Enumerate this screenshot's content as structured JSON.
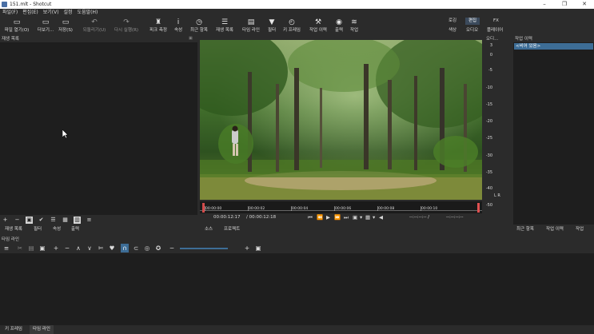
{
  "window": {
    "title": "151.mlt - Shotcut",
    "minimize": "–",
    "maximize": "❐",
    "close": "✕"
  },
  "menu": [
    "파일(F)",
    "편집(E)",
    "보기(V)",
    "설정",
    "도움말(H)"
  ],
  "toolbar": [
    {
      "icon": "▭",
      "label": "파일 열기(O)"
    },
    {
      "icon": "▭",
      "label": "더보기..."
    },
    {
      "icon": "▭",
      "label": "저장(S)"
    },
    {
      "icon": "↶",
      "label": "되돌리기(U)"
    },
    {
      "icon": "↷",
      "label": "다시 실행(R)"
    },
    {
      "icon": "♜",
      "label": "피크 측정"
    },
    {
      "icon": "i",
      "label": "속성"
    },
    {
      "icon": "◷",
      "label": "최근 항목"
    },
    {
      "icon": "☰",
      "label": "재생 목록"
    },
    {
      "icon": "▤",
      "label": "타임 라인"
    },
    {
      "icon": "▼",
      "label": "필터"
    },
    {
      "icon": "◴",
      "label": "키 프레임"
    },
    {
      "icon": "⚒",
      "label": "작업 이력"
    },
    {
      "icon": "◉",
      "label": "출력"
    },
    {
      "icon": "≋",
      "label": "작업"
    }
  ],
  "layouts": {
    "row1": [
      "로깅",
      "편집",
      "FX"
    ],
    "row2": [
      "색상",
      "오디오",
      "플레이어"
    ],
    "active": "편집"
  },
  "playlist": {
    "title": "재생 목록",
    "tools": [
      "+",
      "−",
      "▣",
      "✔",
      "☰",
      "▦",
      "▥",
      "≡"
    ],
    "tabs": [
      "재생 목록",
      "필터",
      "속성",
      "출력"
    ]
  },
  "player": {
    "current_time": "00:00:12:17",
    "total_time": "/ 00:00:12:18",
    "ruler": [
      "00:00:00",
      "00:00:02",
      "00:00:04",
      "00:00:06",
      "00:00:08",
      "00:00:10"
    ],
    "in_point": "--:--:--:-- /",
    "out_point": "--:--:--:--",
    "tabs": [
      "소스",
      "프로젝트"
    ]
  },
  "meter": {
    "title": "오디...",
    "ticks": [
      "3",
      "0",
      "-5",
      "-10",
      "-15",
      "-20",
      "-25",
      "-30",
      "-35",
      "-40",
      "-50"
    ],
    "channels": "L R"
  },
  "history": {
    "title": "작업 이력",
    "items": [
      "<비어 있음>"
    ],
    "tabs": [
      "최근 항목",
      "작업 이력",
      "작업"
    ]
  },
  "timeline": {
    "title": "타임 라인",
    "tools": [
      "≡",
      "✂",
      "▤",
      "▣",
      "+",
      "−",
      "∧",
      "∨",
      "✄",
      "♥",
      "∩",
      "⊂",
      "◎",
      "✪",
      "−",
      "+",
      "▣"
    ]
  },
  "bottom_tabs": [
    "키 프레임",
    "타임 라인"
  ],
  "colors": {
    "accent": "#3d6d96",
    "panel": "#1e1e1e",
    "chrome": "#2b2b2b"
  }
}
